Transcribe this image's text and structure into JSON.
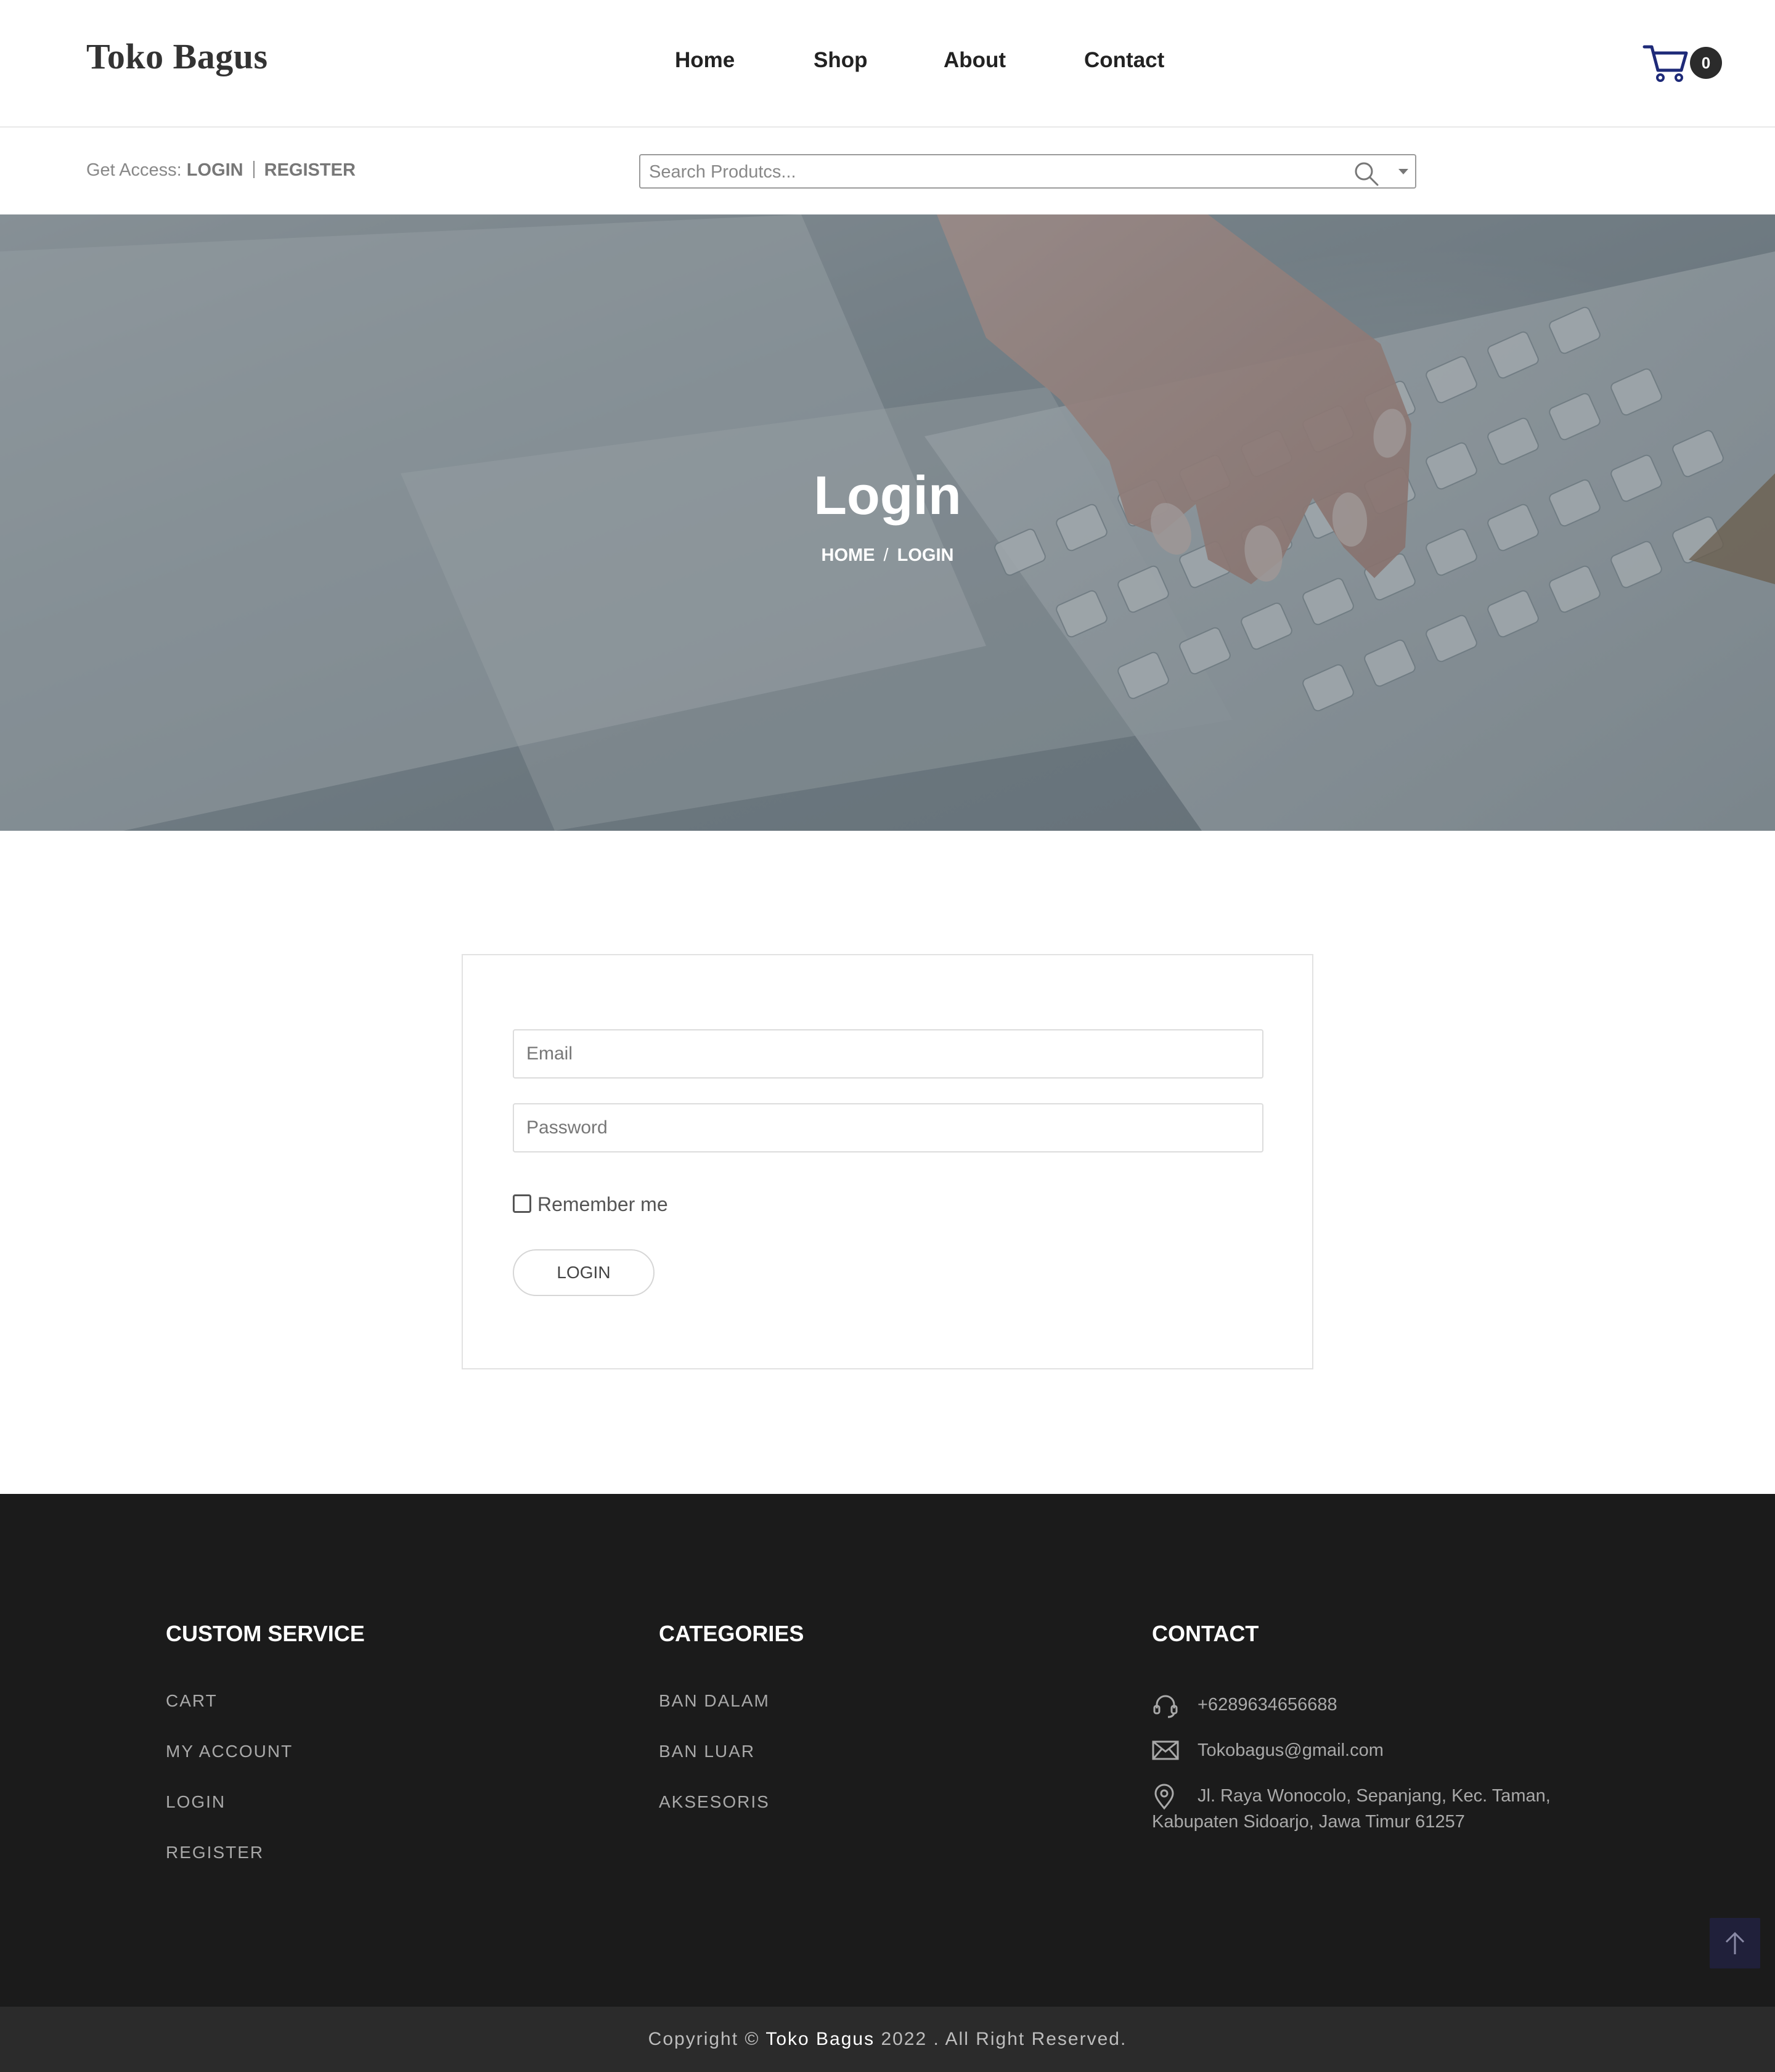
{
  "brand": {
    "name": "Toko Bagus"
  },
  "nav": [
    {
      "label": "Home"
    },
    {
      "label": "Shop"
    },
    {
      "label": "About"
    },
    {
      "label": "Contact"
    }
  ],
  "cart": {
    "icon": "cart-icon",
    "count": "0",
    "icon_color": "#1e2a78"
  },
  "access": {
    "prefix": "Get Access:",
    "login": "LOGIN",
    "register": "REGISTER"
  },
  "search": {
    "placeholder": "Search Produtcs...",
    "icon": "search-icon"
  },
  "hero": {
    "title": "Login",
    "breadcrumb": {
      "home": "HOME",
      "separator": "/",
      "current": "LOGIN"
    }
  },
  "login_form": {
    "email_placeholder": "Email",
    "password_placeholder": "Password",
    "remember_label": "Remember me",
    "remember_checked": false,
    "submit_label": "LOGIN"
  },
  "footer": {
    "custom_service": {
      "title": "CUSTOM SERVICE",
      "links": [
        "CART",
        "MY ACCOUNT",
        "LOGIN",
        "REGISTER"
      ]
    },
    "categories": {
      "title": "CATEGORIES",
      "links": [
        "BAN DALAM",
        "BAN LUAR",
        "AKSESORIS"
      ]
    },
    "contact": {
      "title": "CONTACT",
      "phone": "+6289634656688",
      "email": "Tokobagus@gmail.com",
      "address_line1": "Jl. Raya Wonocolo, Sepanjang, Kec. Taman,",
      "address_line2": "Kabupaten Sidoarjo, Jawa Timur 61257"
    },
    "back_to_top_icon": "arrow-up-icon",
    "background": "#1b1b1b"
  },
  "copyright": {
    "prefix": "Copyright ©",
    "brand": "Toko Bagus",
    "suffix": "2022 . All Right Reserved."
  }
}
